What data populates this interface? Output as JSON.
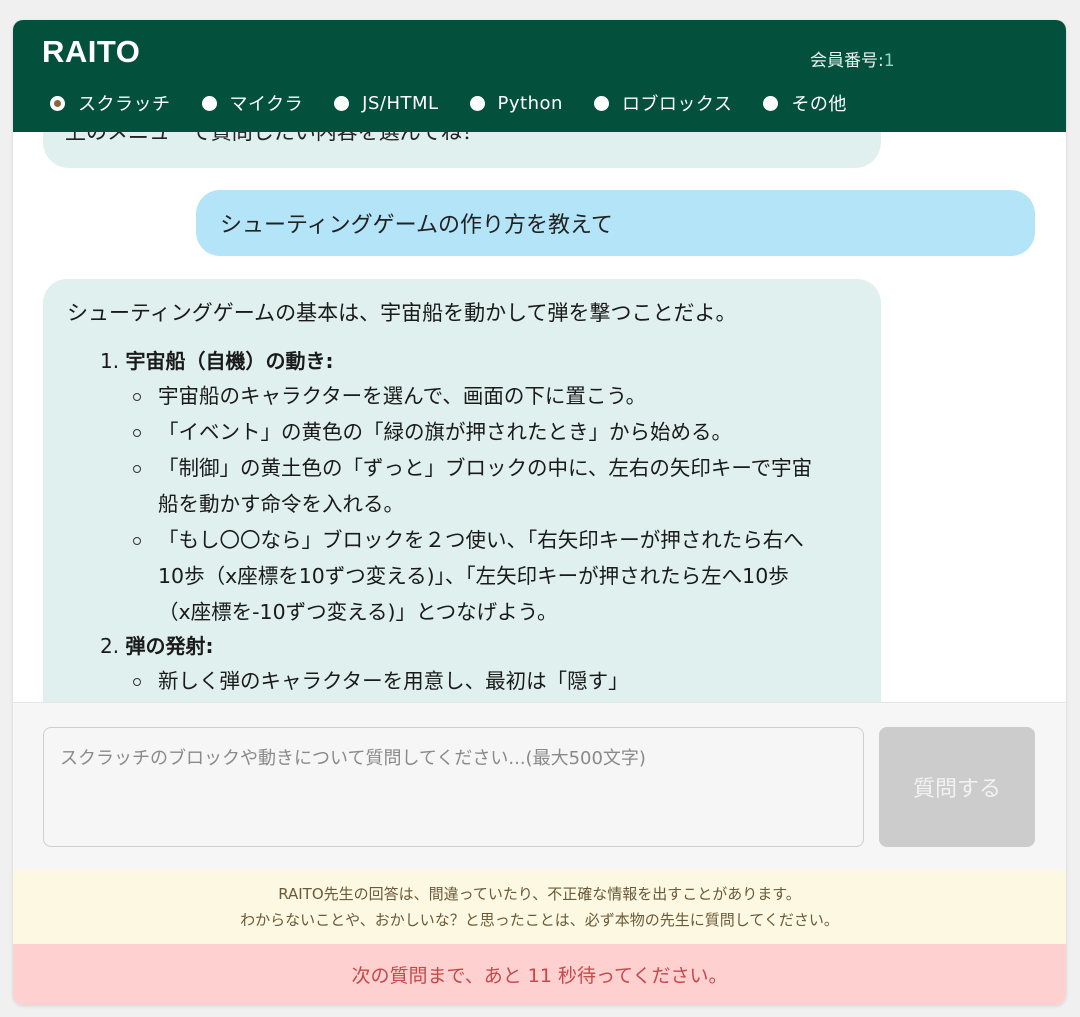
{
  "header": {
    "brand": "RAITO",
    "member_label": "会員番号:",
    "member_value": "1",
    "tabs": [
      {
        "label": "スクラッチ",
        "checked": true
      },
      {
        "label": "マイクラ",
        "checked": false
      },
      {
        "label": "JS/HTML",
        "checked": false
      },
      {
        "label": "Python",
        "checked": false
      },
      {
        "label": "ロブロックス",
        "checked": false
      },
      {
        "label": "その他",
        "checked": false
      }
    ]
  },
  "chat": {
    "previous_bot_text": "上のメニューで質問したい内容を選んでね！",
    "user_message": "シューティングゲームの作り方を教えて",
    "bot_intro": "シューティングゲームの基本は、宇宙船を動かして弾を撃つことだよ。",
    "steps": [
      {
        "num": "1.",
        "title": "宇宙船（自機）の動き:",
        "items": [
          "宇宙船のキャラクターを選んで、画面の下に置こう。",
          "「イベント」の黄色の「緑の旗が押されたとき」から始める。",
          "「制御」の黄土色の「ずっと」ブロックの中に、左右の矢印キーで宇宙船を動かす命令を入れる。",
          "「もし〇〇なら」ブロックを２つ使い、「右矢印キーが押されたら右へ10歩（x座標を10ずつ変える)」、「左矢印キーが押されたら左へ10歩（x座標を-10ずつ変える)」とつなげよう。"
        ]
      },
      {
        "num": "2.",
        "title": "弾の発射:",
        "items": [
          "新しく弾のキャラクターを用意し、最初は「隠す」"
        ]
      }
    ]
  },
  "input": {
    "placeholder": "スクラッチのブロックや動きについて質問してください...(最大500文字)",
    "value": "",
    "ask_label": "質問する"
  },
  "notices": {
    "disclaimer_line1": "RAITO先生の回答は、間違っていたり、不正確な情報を出すことがあります。",
    "disclaimer_line2": "わからないことや、おかしいな？と思ったことは、必ず本物の先生に質問してください。",
    "wait_message": "次の質問まで、あと 11 秒待ってください。"
  },
  "colors": {
    "header_bg": "#03513d",
    "bot_bubble": "#dff0ee",
    "user_bubble": "#b3e4f8",
    "disabled_button": "#cccccc",
    "disclaimer_bg": "#fdf8e2",
    "wait_bg": "#ffd0d0",
    "wait_text": "#c44a4a"
  }
}
